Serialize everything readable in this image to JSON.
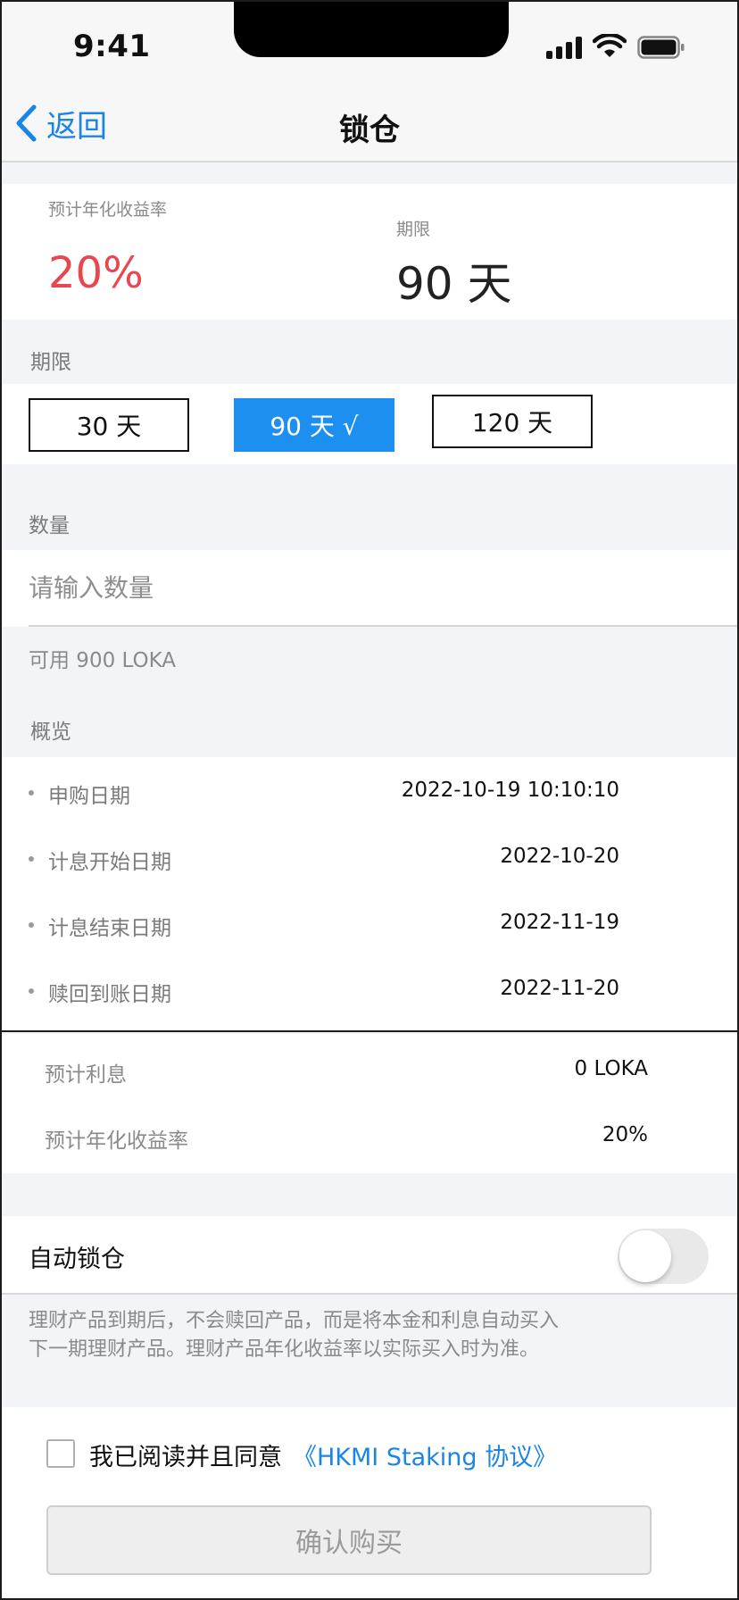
{
  "status_bar": {
    "time": "9:41"
  },
  "nav": {
    "back_label": "返回",
    "title": "锁仓"
  },
  "summary": {
    "rate_label": "预计年化收益率",
    "rate_value": "20%",
    "term_label": "期限",
    "term_value": "90 天"
  },
  "period": {
    "section_label": "期限",
    "options": [
      {
        "label": "30 天",
        "selected": false
      },
      {
        "label": "90 天 √",
        "selected": true
      },
      {
        "label": "120 天",
        "selected": false
      }
    ]
  },
  "quantity": {
    "section_label": "数量",
    "placeholder": "请输入数量",
    "value": "",
    "available": "可用 900 LOKA"
  },
  "overview": {
    "section_label": "概览",
    "rows": [
      {
        "label": "申购日期",
        "value": "2022-10-19 10:10:10"
      },
      {
        "label": "计息开始日期",
        "value": "2022-10-20"
      },
      {
        "label": "计息结束日期",
        "value": "2022-11-19"
      },
      {
        "label": "赎回到账日期",
        "value": "2022-11-20"
      }
    ]
  },
  "estimate": {
    "interest_label": "预计利息",
    "interest_value": "0 LOKA",
    "rate_label": "预计年化收益率",
    "rate_value": "20%"
  },
  "auto_lock": {
    "label": "自动锁仓",
    "enabled": false,
    "description_line1": "理财产品到期后，不会赎回产品，而是将本金和利息自动买入",
    "description_line2": "下一期理财产品。理财产品年化收益率以实际买入时为准。"
  },
  "agreement": {
    "checked": false,
    "text": "我已阅读并且同意",
    "link_text": "《HKMI Staking 协议》"
  },
  "confirm_button": {
    "label": "确认购买",
    "disabled": true
  },
  "colors": {
    "accent": "#1a84e8",
    "selected_option": "#1d8ff0",
    "rate_red": "#e8474f",
    "page_bg": "#f2f4f7"
  },
  "icons": {
    "back": "chevron-left-icon",
    "signal": "cellular-signal-icon",
    "wifi": "wifi-icon",
    "battery": "battery-icon"
  }
}
